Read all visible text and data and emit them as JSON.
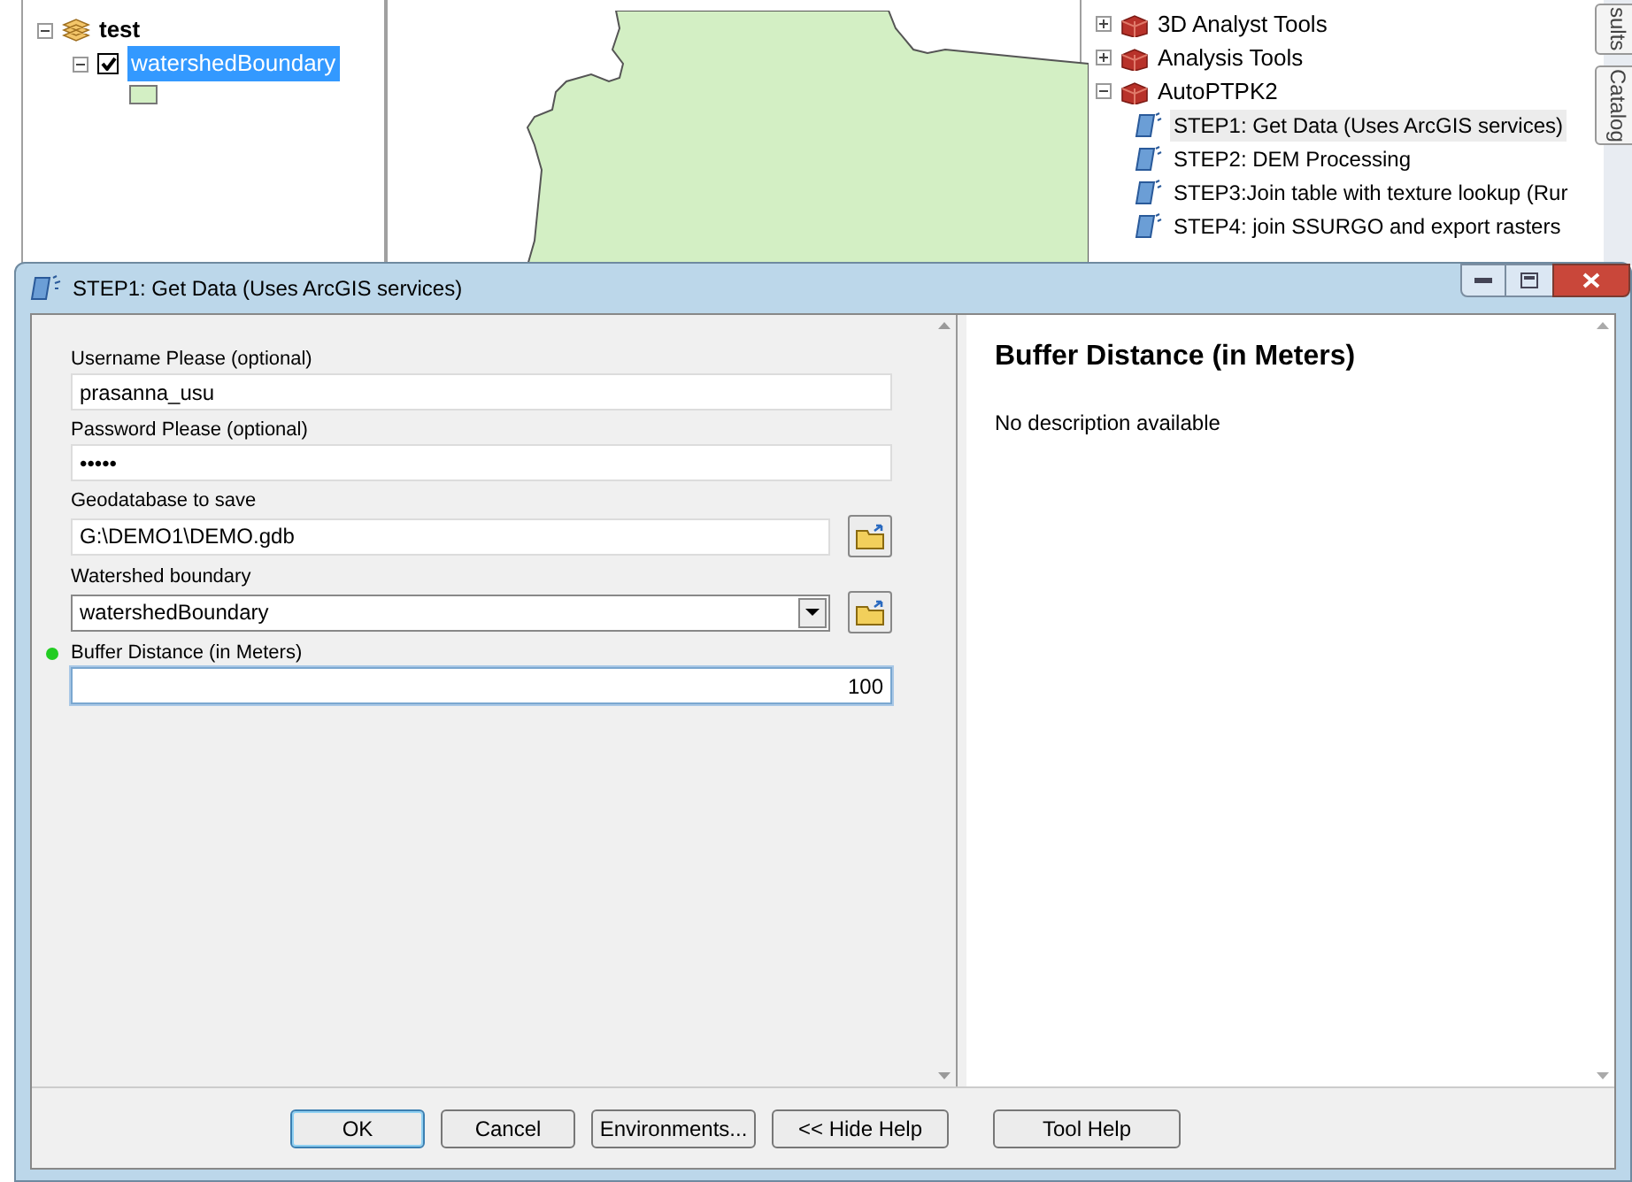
{
  "table_of_contents": {
    "layers": [
      {
        "name": "test",
        "expanded": true,
        "children": [
          {
            "name": "watershedBoundary",
            "expanded": true,
            "checked": true,
            "selected": true
          }
        ]
      }
    ]
  },
  "catalog": {
    "items": [
      {
        "label": "3D Analyst Tools",
        "expanded": false
      },
      {
        "label": "Analysis Tools",
        "expanded": false
      },
      {
        "label": "AutoPTPK2",
        "expanded": true,
        "children": [
          {
            "label": "STEP1: Get Data (Uses ArcGIS services)",
            "selected": true
          },
          {
            "label": "STEP2: DEM Processing",
            "selected": false
          },
          {
            "label": "STEP3:Join table with texture lookup (Rur",
            "selected": false
          },
          {
            "label": "STEP4: join SSURGO and export rasters",
            "selected": false
          }
        ]
      }
    ]
  },
  "side_tabs": [
    {
      "label": "sults"
    },
    {
      "label": "Catalog"
    }
  ],
  "dialog": {
    "title": "STEP1: Get Data (Uses ArcGIS services)",
    "parameters": [
      {
        "kind": "text",
        "label": "Username Please (optional)",
        "value": "prasanna_usu",
        "active": false
      },
      {
        "kind": "text",
        "label": "Password Please (optional)",
        "value": "•••••",
        "active": false
      },
      {
        "kind": "path",
        "label": "Geodatabase to save",
        "value": "G:\\DEMO1\\DEMO.gdb",
        "active": false
      },
      {
        "kind": "dropdown",
        "label": "Watershed boundary",
        "value": "watershedBoundary",
        "active": false
      },
      {
        "kind": "number",
        "label": "Buffer Distance (in Meters)",
        "value": "100",
        "active": true
      }
    ],
    "help": {
      "title": "Buffer Distance (in Meters)",
      "text": "No description available"
    },
    "buttons": [
      {
        "label": "OK",
        "default": true
      },
      {
        "label": "Cancel",
        "default": false
      },
      {
        "label": "Environments...",
        "default": false
      },
      {
        "label": "<< Hide Help",
        "default": false
      },
      {
        "label": "Tool Help",
        "default": false
      }
    ]
  }
}
